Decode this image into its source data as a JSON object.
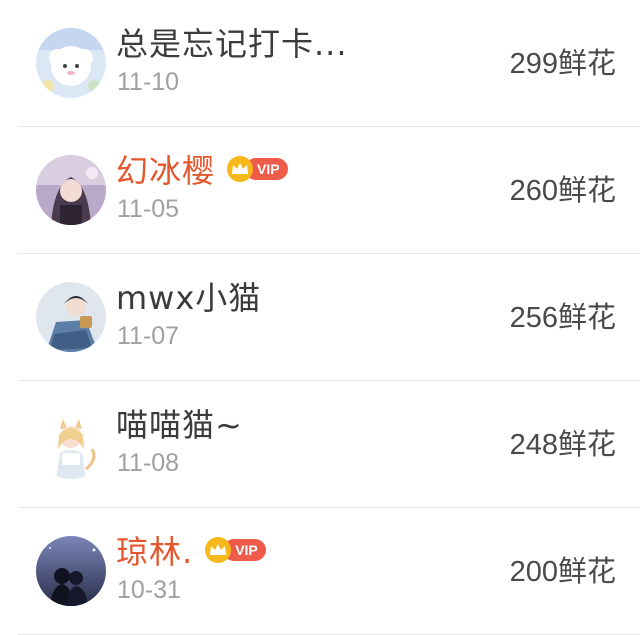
{
  "vip_label": "VIP",
  "colors": {
    "vip_name": "#e4572e",
    "normal_name": "#3b3b3b",
    "date": "#a0a0a0",
    "vip_pill": "#ee5b49",
    "vip_crown": "#f6b81a"
  },
  "rows": [
    {
      "name": "总是忘记打卡...",
      "date": "11-10",
      "count": "299",
      "unit": "鲜花",
      "vip": false,
      "avatar_icon": "cartoon-sheep-avatar"
    },
    {
      "name": "幻冰樱",
      "date": "11-05",
      "count": "260",
      "unit": "鲜花",
      "vip": true,
      "avatar_icon": "anime-girl-avatar"
    },
    {
      "name": "mwx小猫",
      "date": "11-07",
      "count": "256",
      "unit": "鲜花",
      "vip": false,
      "avatar_icon": "anime-girl-blue-avatar"
    },
    {
      "name": "喵喵猫~",
      "date": "11-08",
      "count": "248",
      "unit": "鲜花",
      "vip": false,
      "avatar_icon": "cat-girl-avatar"
    },
    {
      "name": "琼林.",
      "date": "10-31",
      "count": "200",
      "unit": "鲜花",
      "vip": true,
      "avatar_icon": "night-couple-avatar"
    }
  ]
}
